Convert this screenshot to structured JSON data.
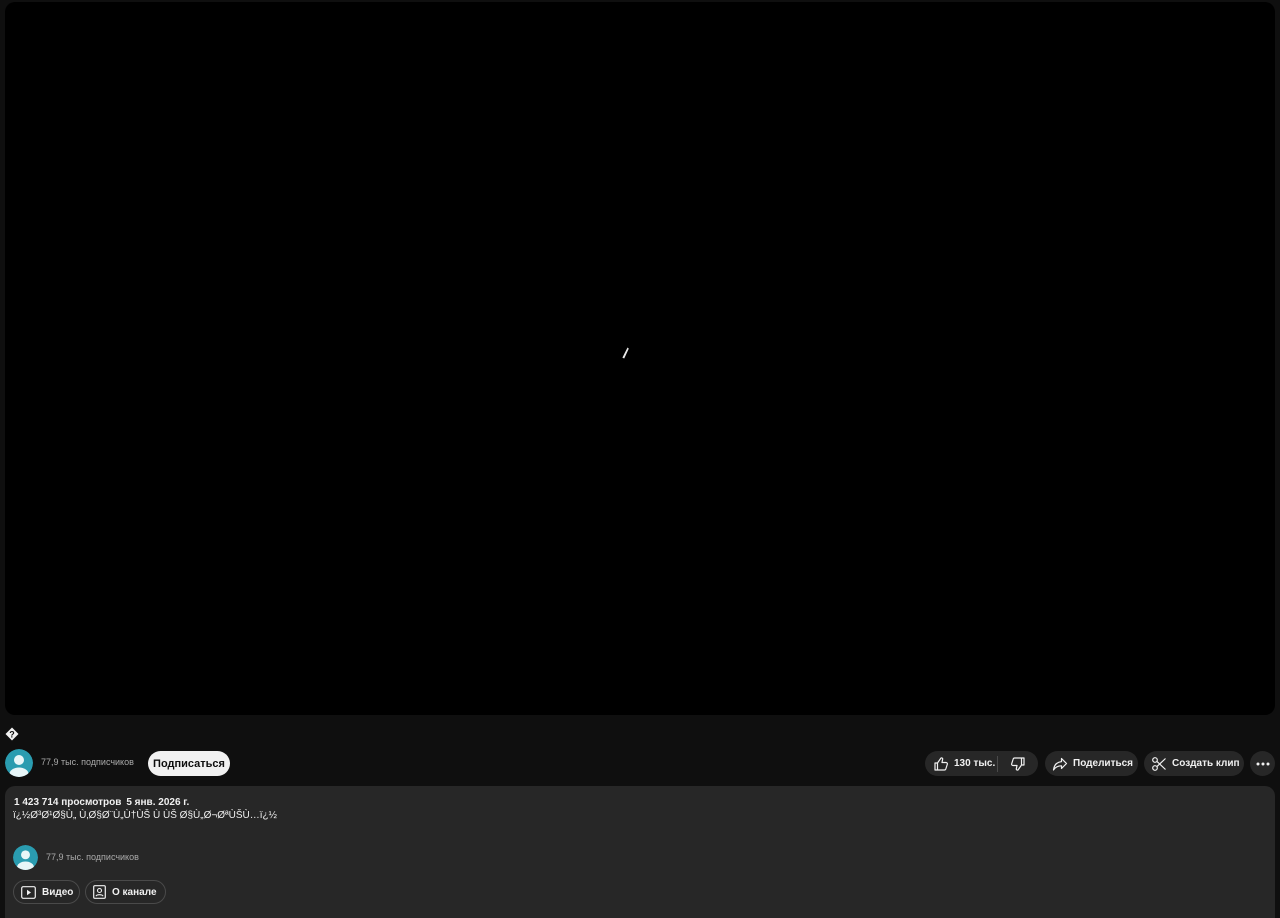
{
  "player": {
    "state": "loading",
    "spinner_icon": "loading-spinner-icon"
  },
  "title": {
    "glyph": "?"
  },
  "channel": {
    "avatar_icon": "default-avatar-icon",
    "subscribers": "77,9 тыс. подписчиков",
    "subscribe_label": "Подписаться"
  },
  "actions": {
    "like_count": "130 тыс.",
    "like_icon": "thumbs-up-icon",
    "dislike_icon": "thumbs-down-icon",
    "share_label": "Поделиться",
    "share_icon": "share-arrow-icon",
    "clip_label": "Создать клип",
    "clip_icon": "scissors-icon",
    "more_icon": "more-horizontal-icon"
  },
  "description": {
    "views": "1 423 714 просмотров",
    "date": "5 янв. 2026 г.",
    "text": "ï¿½Ø³Ø¹Ø§Ù„ Ù‚Ø§Ø¨Ù„Ù†ÙŠ Ù ÙŠ Ø§Ù„Ø¬ØªÙŠÙ…ï¿½",
    "channel_subscribers": "77,9 тыс. подписчиков",
    "videos_label": "Видео",
    "videos_icon": "video-play-icon",
    "about_label": "О канале",
    "about_icon": "profile-card-icon"
  },
  "colors": {
    "background": "#0f0f0f",
    "player": "#000000",
    "panel": "#272727",
    "avatar": "#2a9cb0",
    "text": "#f1f1f1",
    "muted": "#aaaaaa"
  }
}
